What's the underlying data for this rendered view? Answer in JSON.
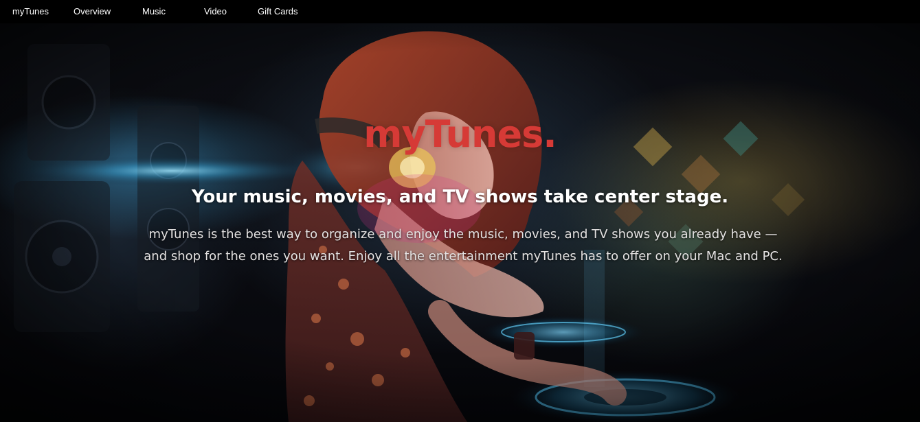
{
  "nav": {
    "items": [
      {
        "label": "myTunes"
      },
      {
        "label": "Overview"
      },
      {
        "label": "Music"
      },
      {
        "label": "Video"
      },
      {
        "label": "Gift Cards"
      }
    ]
  },
  "hero": {
    "brand": "myTunes.",
    "headline": "Your music, movies, and TV shows take center stage.",
    "description": "myTunes is the best way to organize and enjoy the music, movies, and TV shows you already have — and shop for the ones you want. Enjoy all the entertainment myTunes has to offer on your Mac and PC.",
    "background_image": "dj-girl-with-headphones-illustration"
  },
  "colors": {
    "nav_background": "#000000",
    "brand_red": "#d63a36",
    "text_white": "#ffffff"
  }
}
